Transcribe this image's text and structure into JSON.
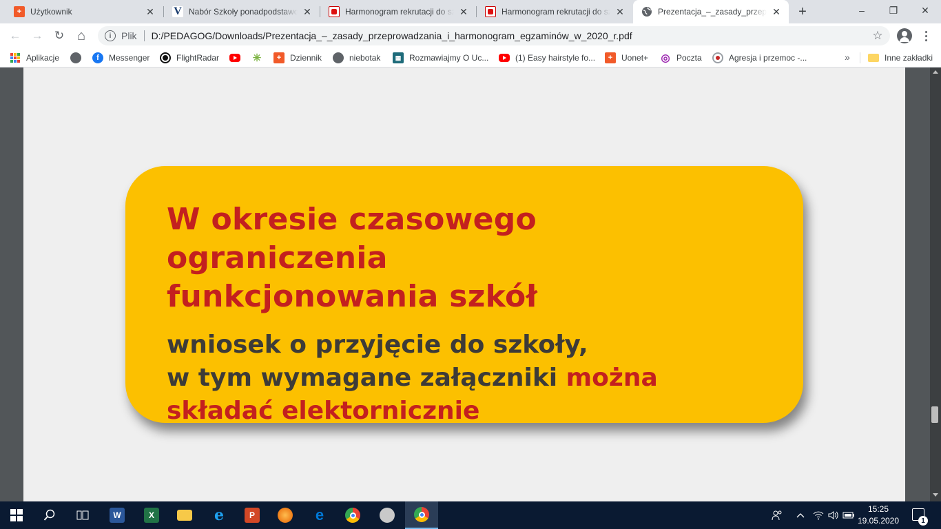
{
  "tabs": [
    {
      "label": "Użytkownik",
      "favicon": "orange-plus-icon",
      "active": false
    },
    {
      "label": "Nabór Szkoły ponadpodstawowe",
      "favicon": "v-logo-icon",
      "active": false
    },
    {
      "label": "Harmonogram rekrutacji do szkół",
      "favicon": "eagle-emblem-icon",
      "active": false
    },
    {
      "label": "Harmonogram rekrutacji do szkół",
      "favicon": "eagle-emblem-icon",
      "active": false
    },
    {
      "label": "Prezentacja_–_zasady_przeprowadzania",
      "favicon": "globe-icon",
      "active": true
    }
  ],
  "window": {
    "minimize": "–",
    "maximize": "❐",
    "close": "✕",
    "new_tab": "+"
  },
  "toolbar": {
    "back": "←",
    "forward": "→",
    "reload": "↻",
    "home": "⌂",
    "scheme": "Plik",
    "url": "D:/PEDAGOG/Downloads/Prezentacja_–_zasady_przeprowadzania_i_harmonogram_egzaminów_w_2020_r.pdf",
    "star": "☆"
  },
  "bookmarks": [
    {
      "label": "Aplikacje",
      "icon": "apps-grid-icon"
    },
    {
      "label": "",
      "icon": "globe-icon"
    },
    {
      "label": "Messenger",
      "icon": "facebook-icon"
    },
    {
      "label": "FlightRadar",
      "icon": "flightradar-icon"
    },
    {
      "label": "",
      "icon": "youtube-icon"
    },
    {
      "label": "",
      "icon": "spark-icon"
    },
    {
      "label": "Dziennik",
      "icon": "orange-plus-icon"
    },
    {
      "label": "niebotak",
      "icon": "globe-icon"
    },
    {
      "label": "Rozmawiajmy O Uc...",
      "icon": "rozmawiajmy-icon"
    },
    {
      "label": "(1) Easy hairstyle fo...",
      "icon": "youtube-icon"
    },
    {
      "label": "Uonet+",
      "icon": "orange-plus-icon"
    },
    {
      "label": "Poczta",
      "icon": "poczta-icon"
    },
    {
      "label": "Agresja i przemoc -...",
      "icon": "agresja-icon"
    }
  ],
  "bookmarks_more": "»",
  "bookmarks_other": "Inne zakładki",
  "slide": {
    "headline_line1": "W okresie czasowego ograniczenia",
    "headline_line2": "funkcjonowania szkół",
    "body_line1": "wniosek o przyjęcie do szkoły,",
    "body_line2_a": "w tym wymagane załączniki ",
    "body_line2_b": "można",
    "body_line3": "składać elektornicznie",
    "card_color": "#fcc000",
    "headline_color": "#c3201f",
    "body_color": "#3d3b38"
  },
  "taskbar": {
    "apps": [
      "start-icon",
      "search-icon",
      "task-view-icon",
      "word-icon",
      "excel-icon",
      "explorer-icon",
      "ie-icon",
      "powerpoint-icon",
      "firefox-icon",
      "edge-icon",
      "chrome-icon",
      "paint-icon",
      "chrome-icon"
    ],
    "time": "15:25",
    "date": "19.05.2020",
    "notifications": "1"
  }
}
